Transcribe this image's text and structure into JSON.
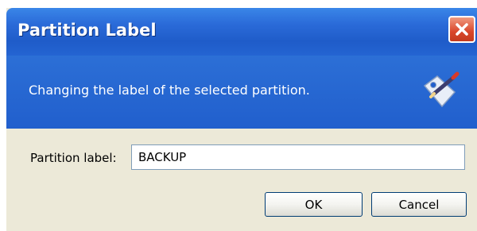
{
  "window": {
    "title": "Partition Label",
    "close_icon": "close-icon"
  },
  "header": {
    "description": "Changing the label of the selected partition.",
    "icon": "label-tag-pencil-icon"
  },
  "form": {
    "field_label": "Partition label:",
    "field_value": "BACKUP"
  },
  "buttons": {
    "ok_label": "OK",
    "cancel_label": "Cancel"
  },
  "colors": {
    "titlebar": "#2a6ad8",
    "header_band": "#215fcd",
    "dialog_body": "#ece9d8",
    "close_button": "#d9472b"
  }
}
